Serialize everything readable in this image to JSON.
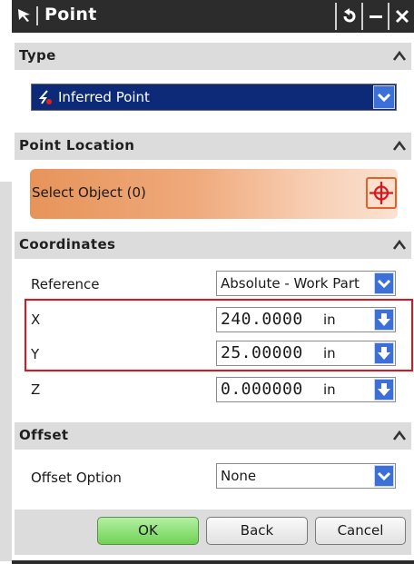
{
  "window": {
    "title": "Point"
  },
  "type_section": {
    "header": "Type",
    "selected": "Inferred Point"
  },
  "point_location": {
    "header": "Point Location",
    "select_object_label": "Select Object (0)"
  },
  "coordinates": {
    "header": "Coordinates",
    "reference_label": "Reference",
    "reference_value": "Absolute - Work Part",
    "x_label": "X",
    "x_value": "240.0000",
    "x_unit": "in",
    "y_label": "Y",
    "y_value": "25.00000",
    "y_unit": "in",
    "z_label": "Z",
    "z_value": "0.000000",
    "z_unit": "in"
  },
  "offset": {
    "header": "Offset",
    "option_label": "Offset Option",
    "option_value": "None"
  },
  "buttons": {
    "ok": "OK",
    "back": "Back",
    "cancel": "Cancel"
  },
  "colors": {
    "accent_highlight": "#e0141c",
    "ok_green": "#6fd255",
    "selection_blue": "#0c2a78",
    "select_orange": "#e7945a"
  }
}
